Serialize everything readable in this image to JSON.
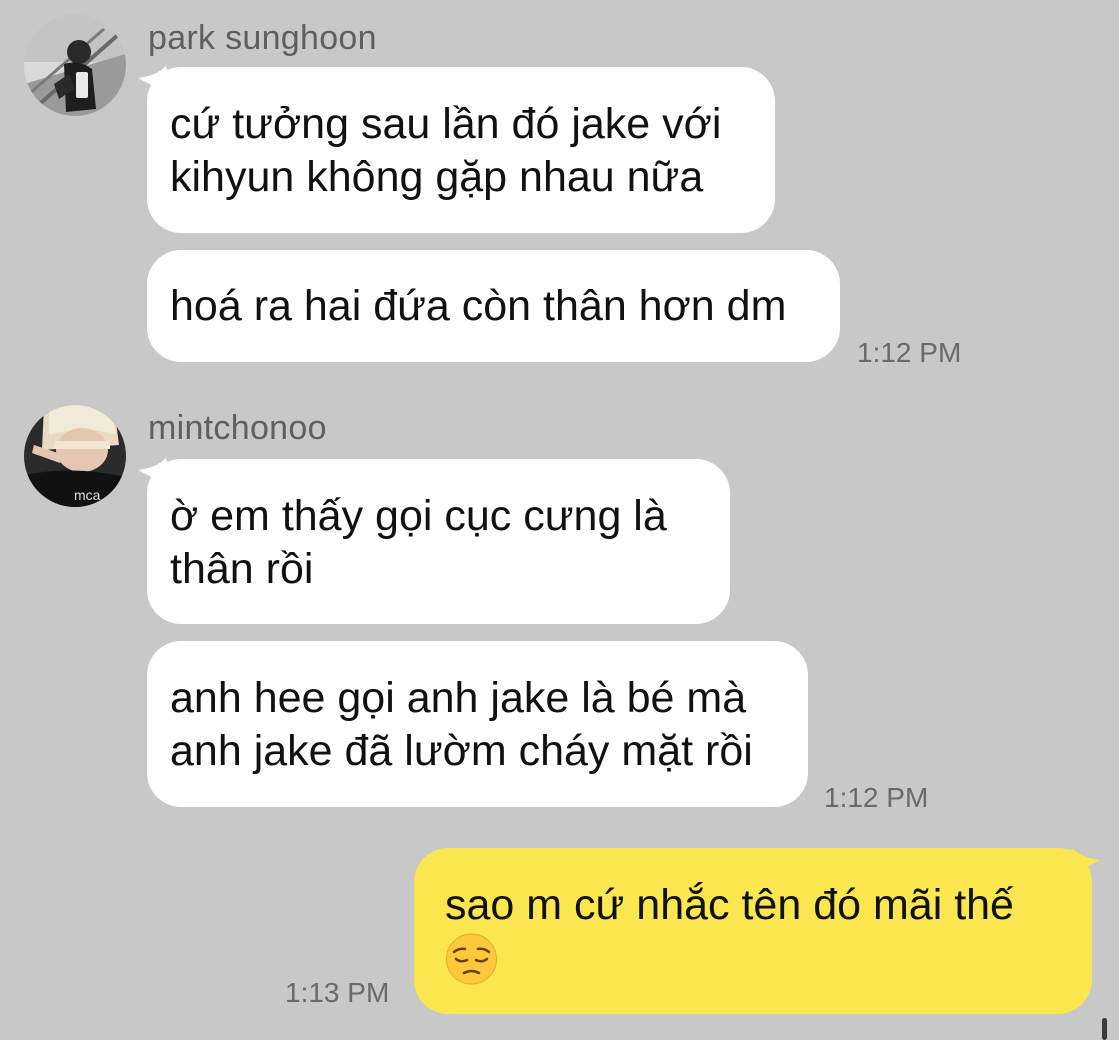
{
  "conversation": {
    "groups": [
      {
        "sender": "park sunghoon",
        "avatar_icon": "avatar-photo",
        "messages": [
          {
            "lines": [
              "cứ tưởng sau lần đó jake với",
              "kihyun không gặp nhau nữa"
            ]
          },
          {
            "lines": [
              "hoá ra hai đứa còn thân hơn dm"
            ]
          }
        ],
        "time": "1:12 PM"
      },
      {
        "sender": "mintchonoo",
        "avatar_icon": "avatar-photo",
        "messages": [
          {
            "lines": [
              "ờ em thấy gọi cục cưng là",
              "thân rồi"
            ]
          },
          {
            "lines": [
              "anh hee gọi anh jake là bé mà",
              "anh jake đã lườm cháy mặt rồi"
            ]
          }
        ],
        "time": "1:12 PM"
      }
    ],
    "my_message": {
      "lines": [
        "sao m cứ nhắc tên đó mãi thế"
      ],
      "emoji": "pensive-face-emoji",
      "time": "1:13 PM"
    }
  },
  "colors": {
    "background": "#c8c8c8",
    "incoming_bubble": "#ffffff",
    "outgoing_bubble": "#fae64f",
    "sender_name": "#5f5f5f",
    "timestamp": "#6a6a6a"
  }
}
